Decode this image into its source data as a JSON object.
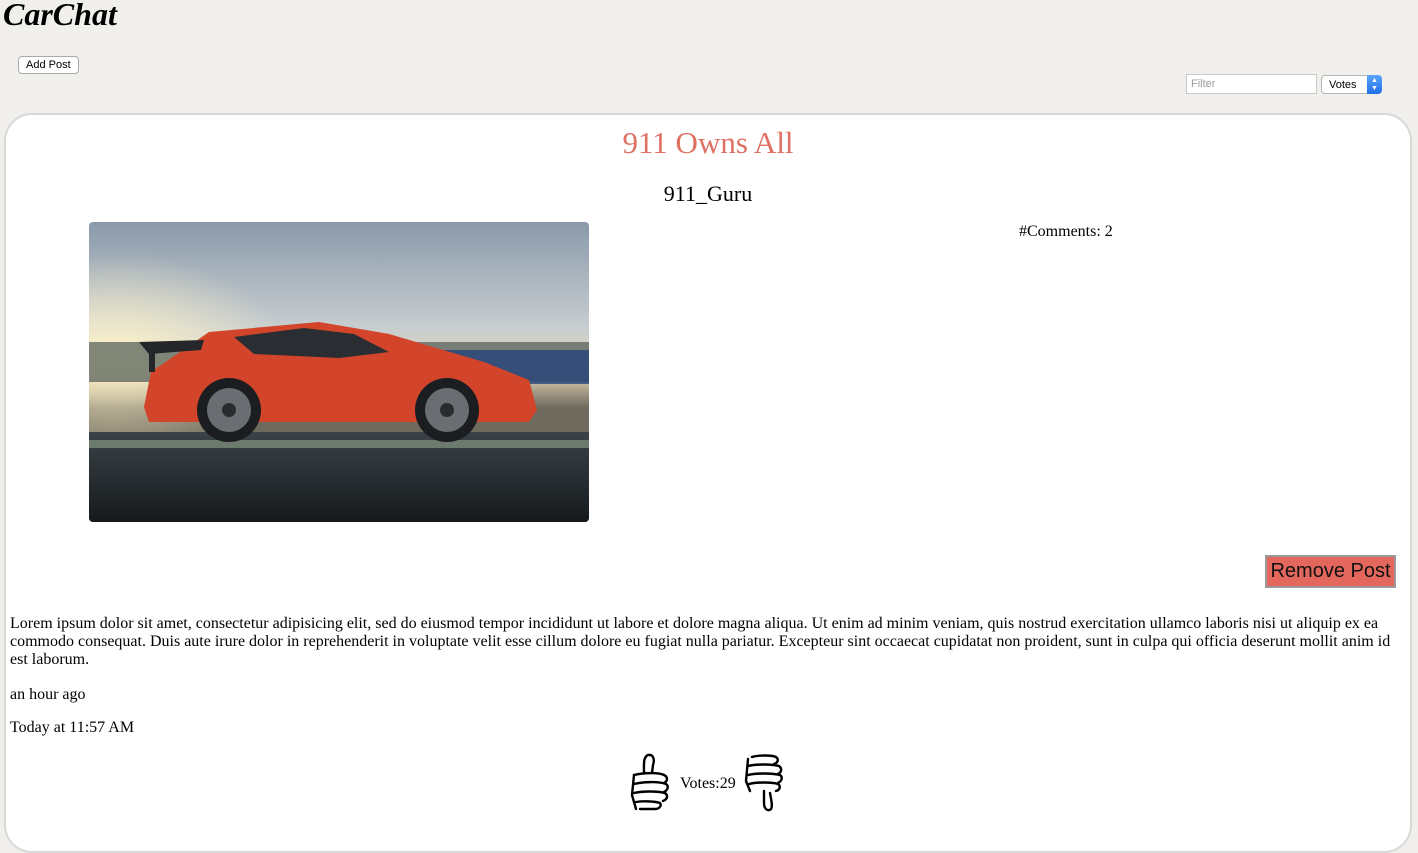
{
  "app": {
    "title": "CarChat"
  },
  "toolbar": {
    "add_post_label": "Add Post",
    "filter_placeholder": "Filter",
    "sort_selected": "Votes"
  },
  "post": {
    "title": "911 Owns All",
    "author": "911_Guru",
    "comments_label": "#Comments: 2",
    "remove_label": "Remove Post",
    "body": "Lorem ipsum dolor sit amet, consectetur adipisicing elit, sed do eiusmod tempor incididunt ut labore et dolore magna aliqua. Ut enim ad minim veniam, quis nostrud exercitation ullamco laboris nisi ut aliquip ex ea commodo consequat. Duis aute irure dolor in reprehenderit in voluptate velit esse cillum dolore eu fugiat nulla pariatur. Excepteur sint occaecat cupidatat non proident, sunt in culpa qui officia deserunt mollit anim id est laborum.",
    "relative_time": "an hour ago",
    "date": "Today at 11:57 AM",
    "votes_label": "Votes:29"
  },
  "colors": {
    "title_accent": "#e07062",
    "remove_button": "#e4675d",
    "page_background": "#f1efec"
  },
  "icons": {
    "upvote": "thumbs-up-icon",
    "downvote": "thumbs-down-icon",
    "select_arrows": "updown-chevron-icon"
  }
}
